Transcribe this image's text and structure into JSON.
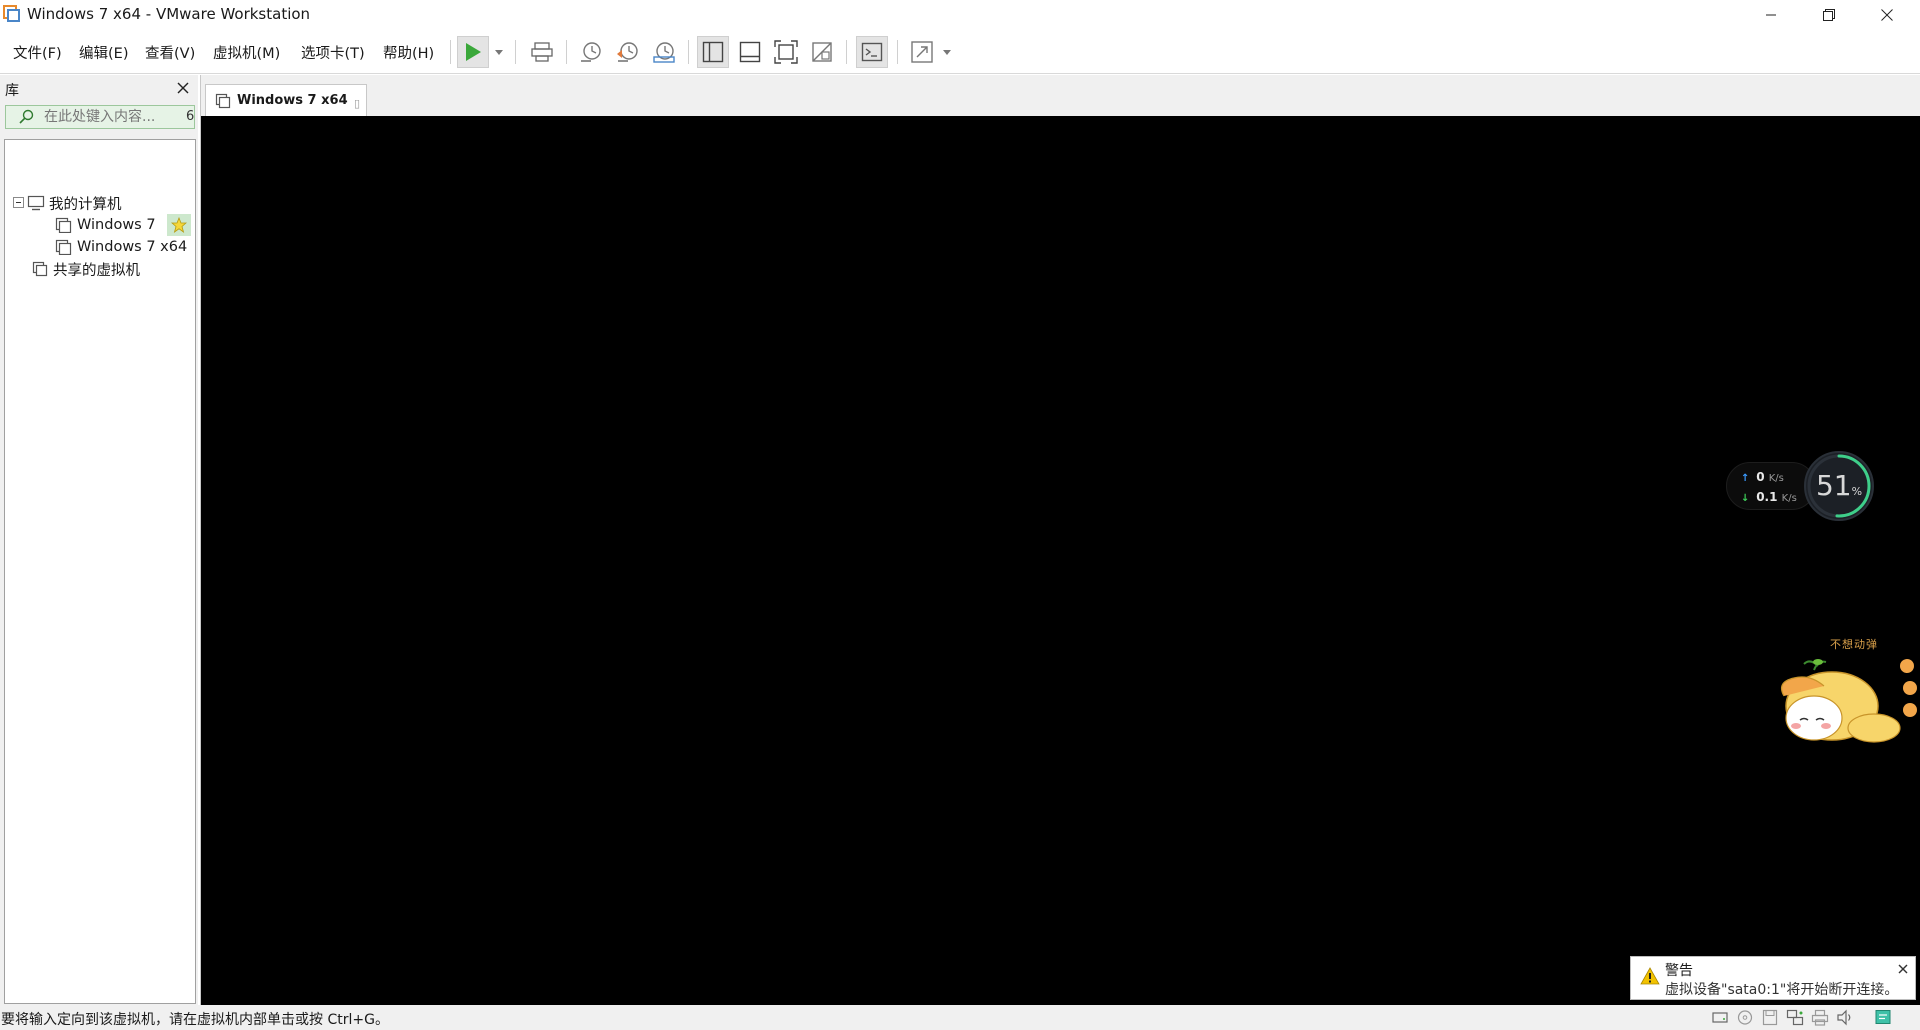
{
  "window": {
    "title": "Windows 7 x64 - VMware Workstation",
    "controls": [
      "minimize",
      "restore",
      "close"
    ]
  },
  "menu": {
    "items": [
      {
        "label": "文件(F)"
      },
      {
        "label": "编辑(E)"
      },
      {
        "label": "查看(V)"
      },
      {
        "label": "虚拟机(M)"
      },
      {
        "label": "选项卡(T)"
      },
      {
        "label": "帮助(H)"
      }
    ]
  },
  "toolbar": {
    "colors": {
      "play": "#3aa83a",
      "revert": "#e07a3c",
      "active_bg": "#e4e4e4"
    },
    "buttons": [
      {
        "icon": "play-icon"
      },
      {
        "icon": "send-ctrl-alt-del-icon"
      },
      {
        "icon": "take-snapshot-icon"
      },
      {
        "icon": "revert-snapshot-icon"
      },
      {
        "icon": "snapshot-manager-icon"
      },
      {
        "icon": "show-library-icon"
      },
      {
        "icon": "thumbnail-bar-icon"
      },
      {
        "icon": "full-screen-icon"
      },
      {
        "icon": "unity-icon"
      },
      {
        "icon": "console-view-icon"
      },
      {
        "icon": "stretch-guest-icon"
      }
    ]
  },
  "library": {
    "title": "库",
    "search": {
      "placeholder": "在此处键入内容...",
      "dropdown": "6"
    },
    "tree": {
      "root": "我的计算机",
      "vms": [
        {
          "label": "Windows 7",
          "favorite": true
        },
        {
          "label": "Windows 7 x64",
          "favorite": false
        }
      ],
      "shared": "共享的虚拟机"
    }
  },
  "tabs": [
    {
      "label": "Windows 7 x64",
      "close": "▯"
    }
  ],
  "overlay": {
    "net": {
      "up_value": "0",
      "up_unit": "K/s",
      "down_value": "0.1",
      "down_unit": "K/s",
      "up_color": "#3b9bff",
      "down_color": "#3ecf5a"
    },
    "gauge": {
      "value": "51",
      "unit": "%",
      "percent": 51,
      "ring_color": "#3ecf8a"
    },
    "mascot_caption": "不想动弹"
  },
  "warning": {
    "title": "警告",
    "message": "虚拟设备\"sata0:1\"将开始断开连接。",
    "icon_color": "#f2c200"
  },
  "status": {
    "text": "要将输入定向到该虚拟机，请在虚拟机内部单击或按 Ctrl+G。",
    "icons": [
      "hard-disk-icon",
      "cd-dvd-icon",
      "floppy-icon",
      "network-icon",
      "printer-icon",
      "sound-icon",
      "message-log-icon"
    ]
  }
}
